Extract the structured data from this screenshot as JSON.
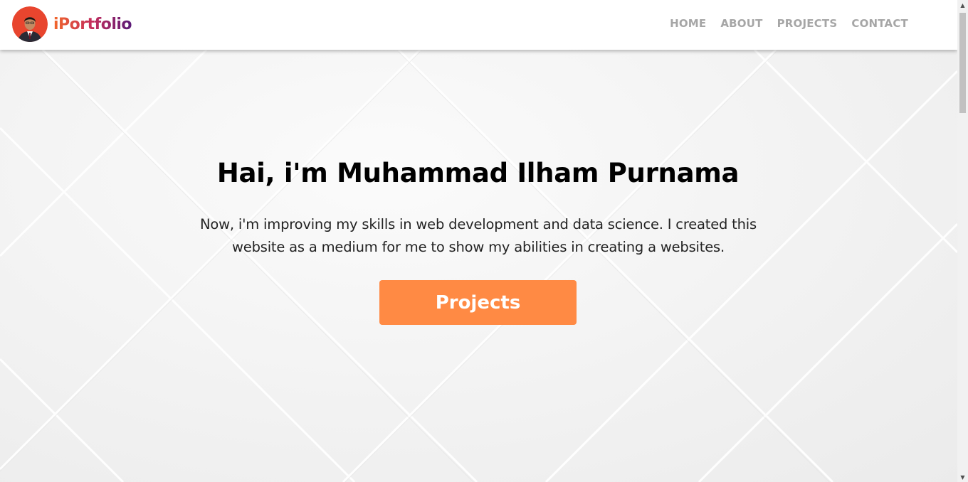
{
  "navbar": {
    "brand": "iPortfolio",
    "links": [
      "HOME",
      "ABOUT",
      "PROJECTS",
      "CONTACT"
    ]
  },
  "hero": {
    "title": "Hai, i'm Muhammad Ilham Purnama",
    "description": "Now, i'm improving my skills in web development and data science. I created this website as a medium for me to show my abilities in creating a websites.",
    "button": "Projects"
  },
  "colors": {
    "accent": "#ff8a44",
    "nav_link": "#a6a6a6",
    "brand_gradient": [
      "#f2672a",
      "#c42d5c",
      "#5a1a78"
    ]
  },
  "icons": {
    "avatar": "profile-photo",
    "scroll_up": "triangle-up-icon",
    "scroll_down": "triangle-down-icon"
  }
}
